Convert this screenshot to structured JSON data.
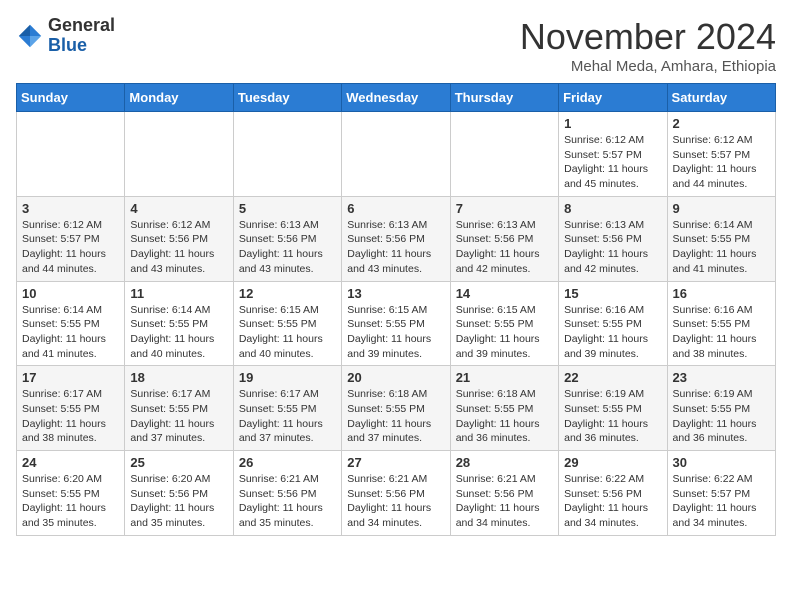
{
  "header": {
    "logo_general": "General",
    "logo_blue": "Blue",
    "month": "November 2024",
    "location": "Mehal Meda, Amhara, Ethiopia"
  },
  "weekdays": [
    "Sunday",
    "Monday",
    "Tuesday",
    "Wednesday",
    "Thursday",
    "Friday",
    "Saturday"
  ],
  "weeks": [
    [
      {
        "day": "",
        "info": ""
      },
      {
        "day": "",
        "info": ""
      },
      {
        "day": "",
        "info": ""
      },
      {
        "day": "",
        "info": ""
      },
      {
        "day": "",
        "info": ""
      },
      {
        "day": "1",
        "info": "Sunrise: 6:12 AM\nSunset: 5:57 PM\nDaylight: 11 hours\nand 45 minutes."
      },
      {
        "day": "2",
        "info": "Sunrise: 6:12 AM\nSunset: 5:57 PM\nDaylight: 11 hours\nand 44 minutes."
      }
    ],
    [
      {
        "day": "3",
        "info": "Sunrise: 6:12 AM\nSunset: 5:57 PM\nDaylight: 11 hours\nand 44 minutes."
      },
      {
        "day": "4",
        "info": "Sunrise: 6:12 AM\nSunset: 5:56 PM\nDaylight: 11 hours\nand 43 minutes."
      },
      {
        "day": "5",
        "info": "Sunrise: 6:13 AM\nSunset: 5:56 PM\nDaylight: 11 hours\nand 43 minutes."
      },
      {
        "day": "6",
        "info": "Sunrise: 6:13 AM\nSunset: 5:56 PM\nDaylight: 11 hours\nand 43 minutes."
      },
      {
        "day": "7",
        "info": "Sunrise: 6:13 AM\nSunset: 5:56 PM\nDaylight: 11 hours\nand 42 minutes."
      },
      {
        "day": "8",
        "info": "Sunrise: 6:13 AM\nSunset: 5:56 PM\nDaylight: 11 hours\nand 42 minutes."
      },
      {
        "day": "9",
        "info": "Sunrise: 6:14 AM\nSunset: 5:55 PM\nDaylight: 11 hours\nand 41 minutes."
      }
    ],
    [
      {
        "day": "10",
        "info": "Sunrise: 6:14 AM\nSunset: 5:55 PM\nDaylight: 11 hours\nand 41 minutes."
      },
      {
        "day": "11",
        "info": "Sunrise: 6:14 AM\nSunset: 5:55 PM\nDaylight: 11 hours\nand 40 minutes."
      },
      {
        "day": "12",
        "info": "Sunrise: 6:15 AM\nSunset: 5:55 PM\nDaylight: 11 hours\nand 40 minutes."
      },
      {
        "day": "13",
        "info": "Sunrise: 6:15 AM\nSunset: 5:55 PM\nDaylight: 11 hours\nand 39 minutes."
      },
      {
        "day": "14",
        "info": "Sunrise: 6:15 AM\nSunset: 5:55 PM\nDaylight: 11 hours\nand 39 minutes."
      },
      {
        "day": "15",
        "info": "Sunrise: 6:16 AM\nSunset: 5:55 PM\nDaylight: 11 hours\nand 39 minutes."
      },
      {
        "day": "16",
        "info": "Sunrise: 6:16 AM\nSunset: 5:55 PM\nDaylight: 11 hours\nand 38 minutes."
      }
    ],
    [
      {
        "day": "17",
        "info": "Sunrise: 6:17 AM\nSunset: 5:55 PM\nDaylight: 11 hours\nand 38 minutes."
      },
      {
        "day": "18",
        "info": "Sunrise: 6:17 AM\nSunset: 5:55 PM\nDaylight: 11 hours\nand 37 minutes."
      },
      {
        "day": "19",
        "info": "Sunrise: 6:17 AM\nSunset: 5:55 PM\nDaylight: 11 hours\nand 37 minutes."
      },
      {
        "day": "20",
        "info": "Sunrise: 6:18 AM\nSunset: 5:55 PM\nDaylight: 11 hours\nand 37 minutes."
      },
      {
        "day": "21",
        "info": "Sunrise: 6:18 AM\nSunset: 5:55 PM\nDaylight: 11 hours\nand 36 minutes."
      },
      {
        "day": "22",
        "info": "Sunrise: 6:19 AM\nSunset: 5:55 PM\nDaylight: 11 hours\nand 36 minutes."
      },
      {
        "day": "23",
        "info": "Sunrise: 6:19 AM\nSunset: 5:55 PM\nDaylight: 11 hours\nand 36 minutes."
      }
    ],
    [
      {
        "day": "24",
        "info": "Sunrise: 6:20 AM\nSunset: 5:55 PM\nDaylight: 11 hours\nand 35 minutes."
      },
      {
        "day": "25",
        "info": "Sunrise: 6:20 AM\nSunset: 5:56 PM\nDaylight: 11 hours\nand 35 minutes."
      },
      {
        "day": "26",
        "info": "Sunrise: 6:21 AM\nSunset: 5:56 PM\nDaylight: 11 hours\nand 35 minutes."
      },
      {
        "day": "27",
        "info": "Sunrise: 6:21 AM\nSunset: 5:56 PM\nDaylight: 11 hours\nand 34 minutes."
      },
      {
        "day": "28",
        "info": "Sunrise: 6:21 AM\nSunset: 5:56 PM\nDaylight: 11 hours\nand 34 minutes."
      },
      {
        "day": "29",
        "info": "Sunrise: 6:22 AM\nSunset: 5:56 PM\nDaylight: 11 hours\nand 34 minutes."
      },
      {
        "day": "30",
        "info": "Sunrise: 6:22 AM\nSunset: 5:57 PM\nDaylight: 11 hours\nand 34 minutes."
      }
    ]
  ]
}
